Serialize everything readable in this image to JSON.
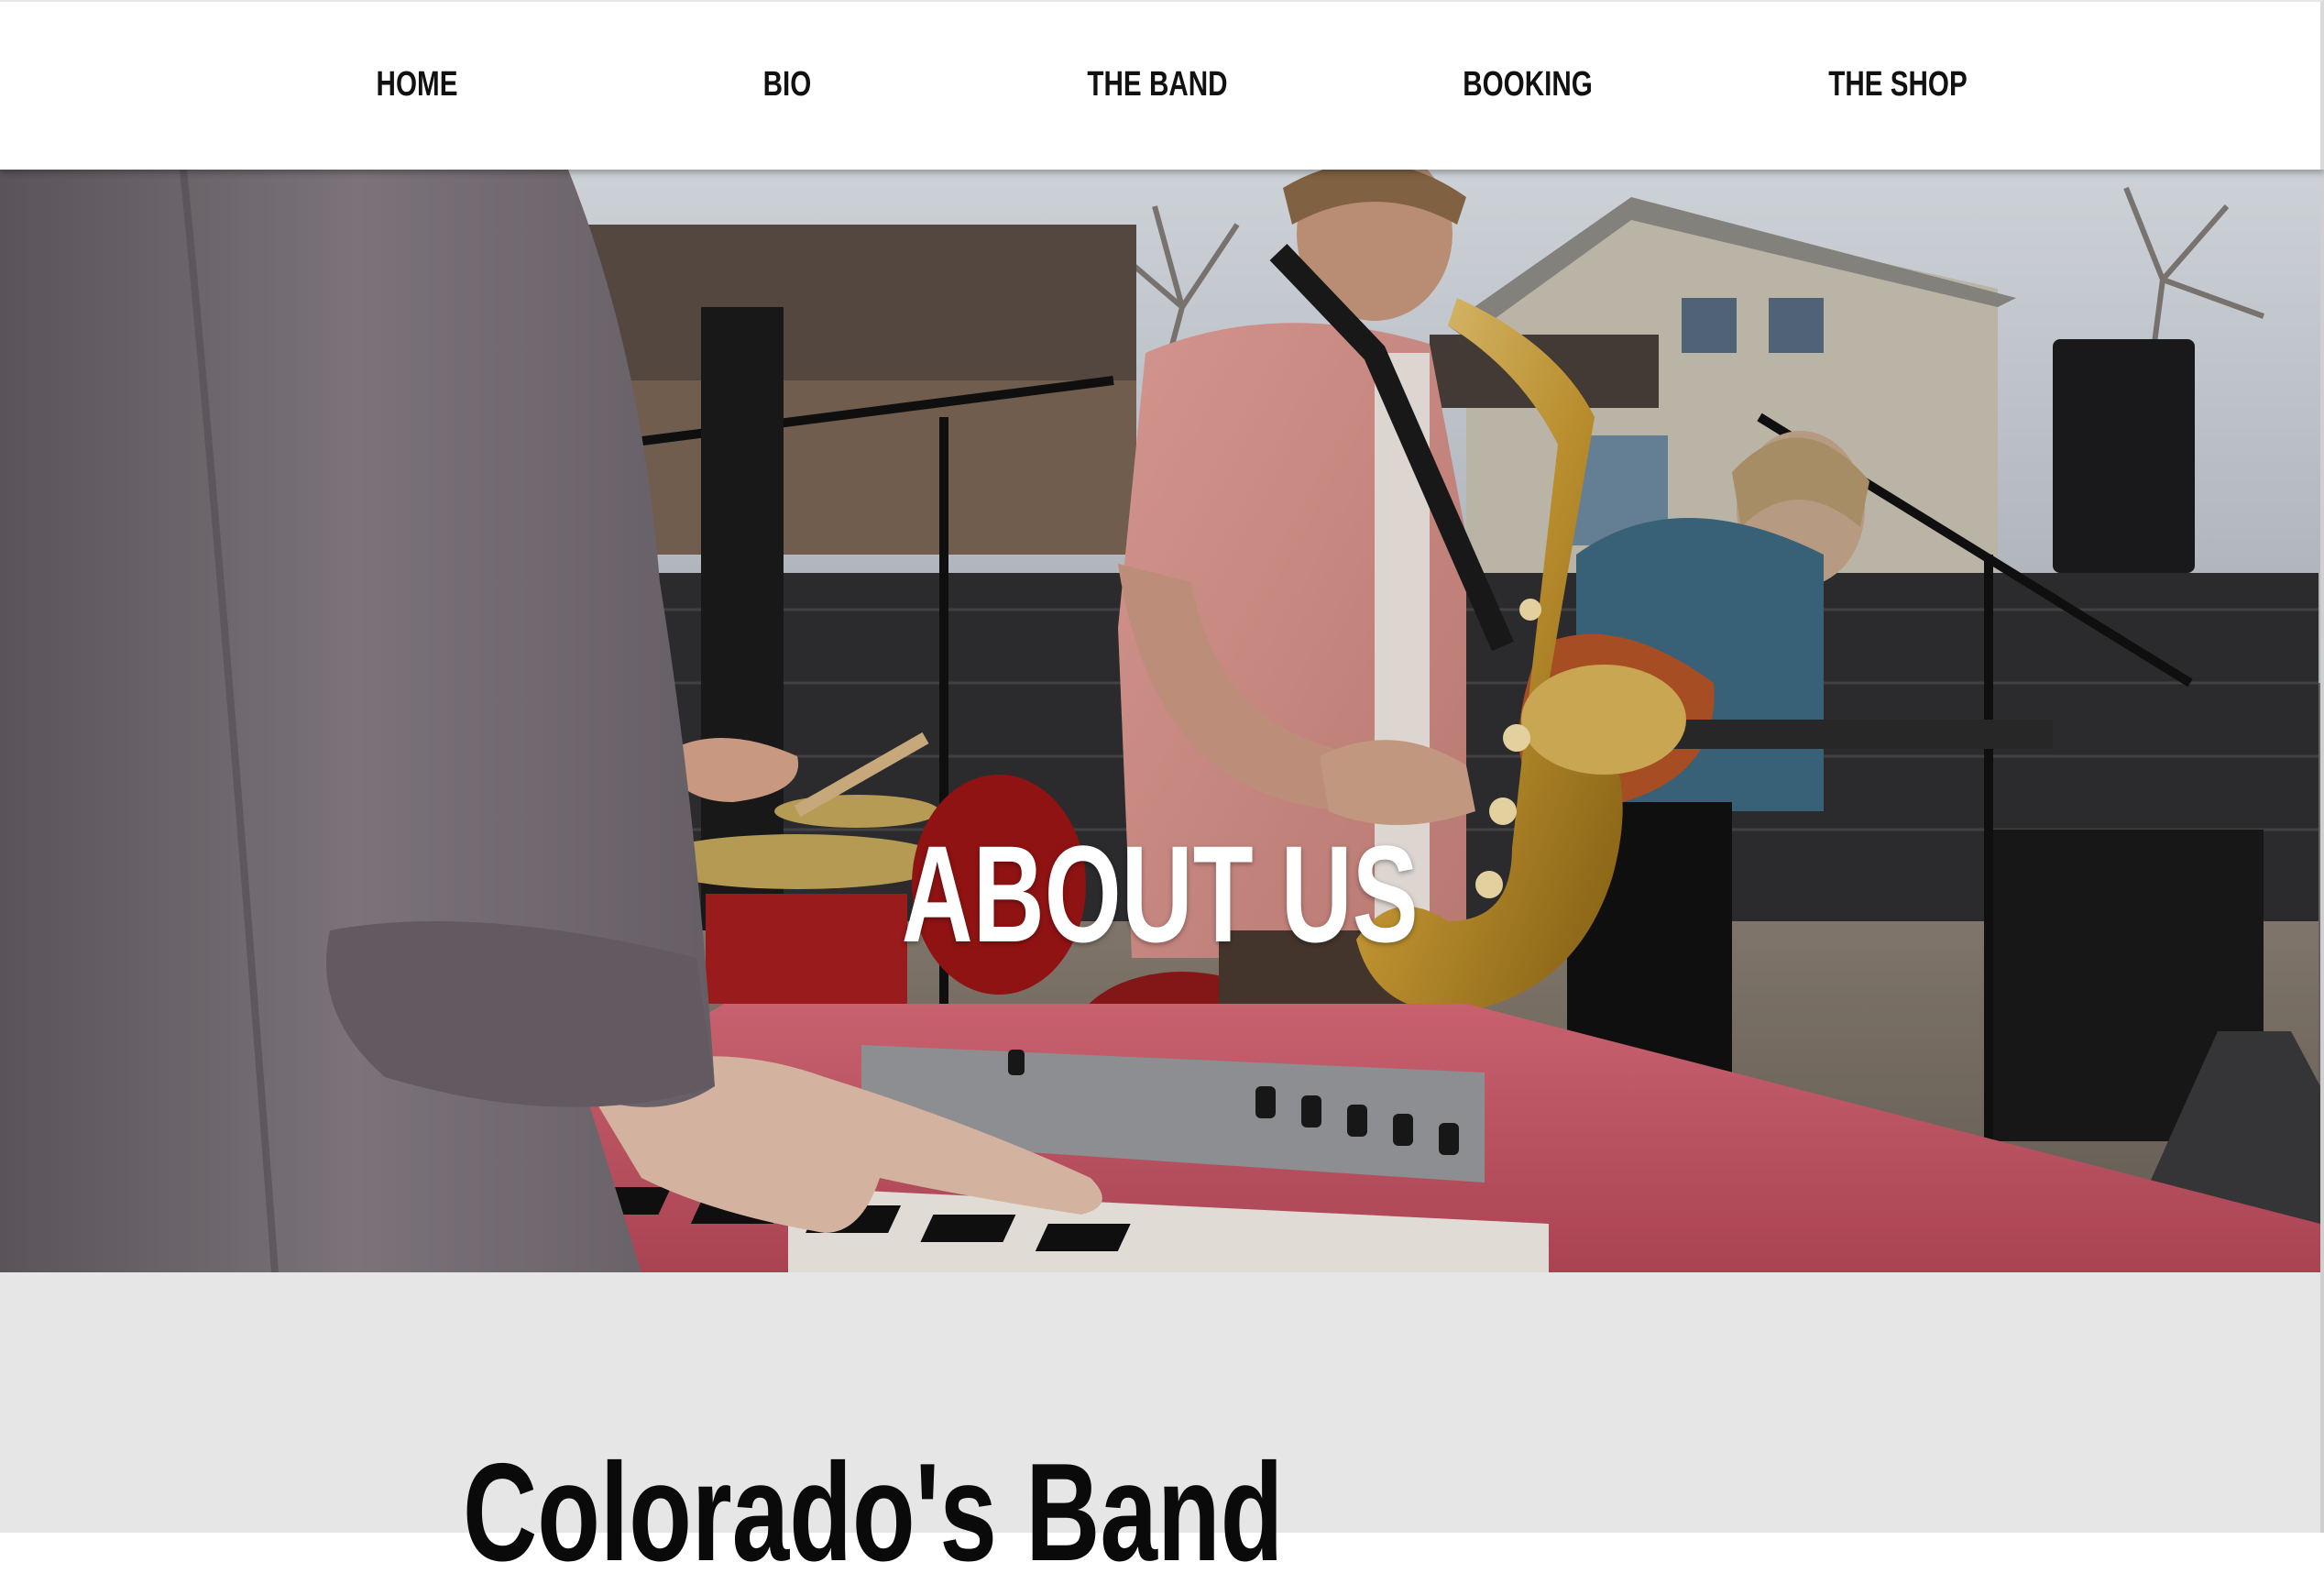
{
  "nav": {
    "items": [
      {
        "label": "HOME"
      },
      {
        "label": "BIO"
      },
      {
        "label": "THE BAND"
      },
      {
        "label": "BOOKING"
      },
      {
        "label": "THE SHOP"
      }
    ]
  },
  "hero": {
    "title": "ABOUT US"
  },
  "main": {
    "heading": "Colorado's Band"
  },
  "colors": {
    "nav_background": "#ffffff",
    "nav_text": "#111111",
    "hero_title": "#ffffff",
    "section_background": "#e6e6e6",
    "heading_text": "#0a0a0a"
  }
}
